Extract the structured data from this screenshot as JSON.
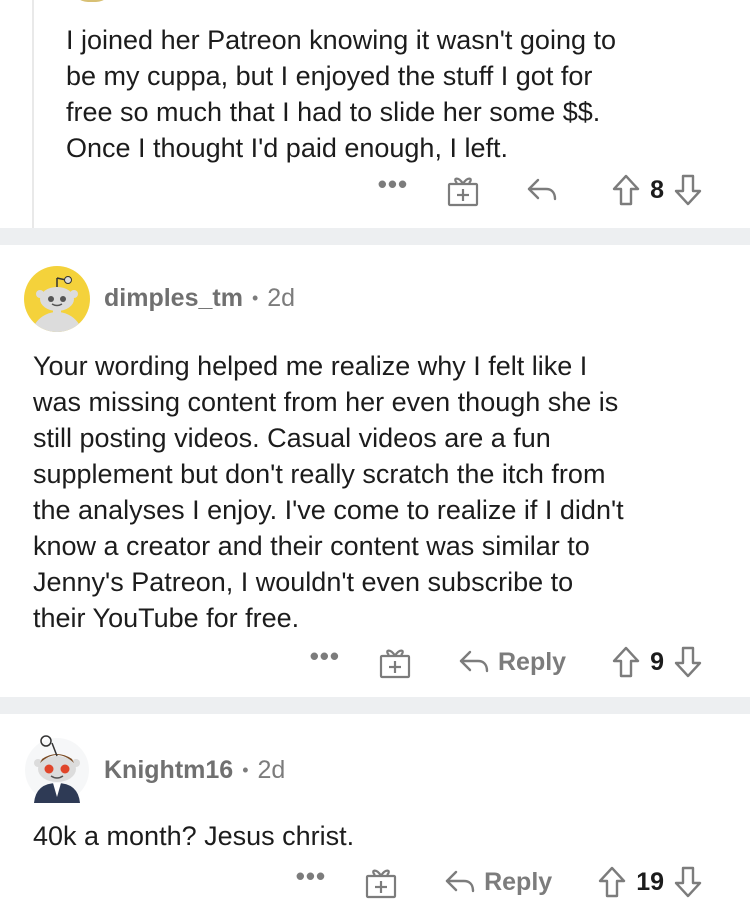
{
  "comments": [
    {
      "body": "I joined her Patreon knowing it wasn't going to be my cuppa, but I enjoyed the stuff I got for free so much that I had to slide her some $$. Once I thought I'd paid enough, I left.",
      "body_lines": [
        "I joined her Patreon knowing it wasn't going to",
        "be my cuppa, but I enjoyed the stuff I got for",
        "free so much that I had to slide her some $$.",
        "Once I thought I'd paid enough, I left."
      ],
      "more": "•••",
      "reply_label": "",
      "votes": "8"
    },
    {
      "username": "dimples_tm",
      "separator": "•",
      "age": "2d",
      "body_lines": [
        "Your wording helped me realize why I felt like I",
        "was missing content from her even though she is",
        "still posting videos. Casual videos are a fun",
        "supplement but don't really scratch the itch from",
        "the analyses I enjoy. I've come to realize if I didn't",
        "know a creator and their content was similar to",
        "Jenny's Patreon, I wouldn't even subscribe to",
        "their YouTube for free."
      ],
      "more": "•••",
      "reply_label": "Reply",
      "votes": "9"
    },
    {
      "username": "Knightm16",
      "separator": "•",
      "age": "2d",
      "body_lines": [
        "40k a month? Jesus christ."
      ],
      "more": "•••",
      "reply_label": "Reply",
      "votes": "19"
    }
  ],
  "icons": {
    "more": "more-options-icon",
    "award": "gift-award-icon",
    "reply": "reply-arrow-icon",
    "upvote": "upvote-arrow-icon",
    "downvote": "downvote-arrow-icon"
  },
  "colors": {
    "separator": "#edeff1",
    "meta_gray": "#7c7c7c",
    "avatar_yellow": "#f4d23b"
  }
}
